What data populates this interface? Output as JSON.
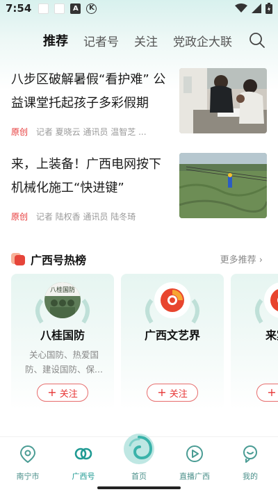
{
  "status_bar": {
    "time": "7:54",
    "k_label": "K",
    "a_label": "A"
  },
  "tabs": [
    {
      "label": "推荐",
      "active": true
    },
    {
      "label": "记者号",
      "active": false
    },
    {
      "label": "关注",
      "active": false
    },
    {
      "label": "党政企大联",
      "active": false
    }
  ],
  "news": [
    {
      "title": "八步区破解暑假“看护难” 公益课堂托起孩子多彩假期",
      "tag": "原创",
      "meta": "记者 夏晓云 通讯员 温智芝 ..."
    },
    {
      "title": "来，上装备！广西电网按下机械化施工“快进键”",
      "tag": "原创",
      "meta": "记者 陆权香 通讯员 陆冬琦"
    }
  ],
  "hot": {
    "title": "广西号热榜",
    "more": "更多推荐 ›",
    "cards": [
      {
        "name": "八桂国防",
        "desc": "关心国防、热爱国防、建设国防、保...",
        "follow": "关注",
        "avatar_text": "八桂国防"
      },
      {
        "name": "广西文艺界",
        "desc": "",
        "follow": "关注"
      },
      {
        "name": "来宾市",
        "desc": "",
        "follow": "关注"
      }
    ]
  },
  "bottom_nav": [
    {
      "label": "南宁市",
      "icon": "location-pin-icon"
    },
    {
      "label": "广西号",
      "icon": "linked-rings-icon",
      "active": true
    },
    {
      "label": "首页",
      "icon": "home-swirl-icon"
    },
    {
      "label": "直播广西",
      "icon": "play-circle-icon"
    },
    {
      "label": "我的",
      "icon": "profile-face-icon"
    }
  ],
  "colors": {
    "accent_red": "#e63535",
    "teal": "#1f9a93",
    "header_bg": "#d8f1ee"
  }
}
